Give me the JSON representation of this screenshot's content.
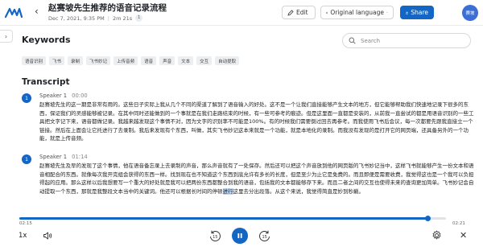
{
  "header": {
    "back_glyph": "‹",
    "title": "赵赛坡先生推荐的语音记录流程",
    "date": "Dec 7, 2021, 9:35 PM",
    "duration": "2m 21s",
    "badge_count": "1",
    "edit_label": "Edit",
    "language_label": "Original language",
    "share_label": "Share",
    "avatar_text": "赛坡"
  },
  "keywords": {
    "title": "Keywords",
    "search_placeholder": "Search",
    "tags": [
      "语音识别",
      "飞书",
      "录制",
      "飞书妙记",
      "上传音频",
      "语音",
      "声音",
      "文本",
      "交互",
      "自动提取"
    ]
  },
  "transcript": {
    "title": "Transcript",
    "segments": [
      {
        "avatar": "1",
        "speaker": "Speaker 1",
        "time": "00:00",
        "text": "赵赛坡先生的这一期是非常有用的。这些日子实际上我从几个不同的渠道了解到了语音输入的好处。这不是一个让我们直接能够产生文本的地方，但它能够帮助我们快速地记录下很多的东西，保证我们的灵感能够被记录。在其中同时还能做到的一个事就是在我们走路结束的时候，有一些可参考的痕迹。但是这里面一直都是安装的，从前我一直尝试的都是用语音识别的一些工具把文字记下来，语音都做记录。我越来越发现这个事情不对，因为文字的识别率不可能是100%。有的时候我们需要倒过回去再参考。而我使用飞书后会议，每一次都要先跟我直接立一个链接。然后在上面会让它托进行了去录制。我后来发现有个东西，叫做，其实飞书妙记这本来就是一个功能，就是本地化的录制。而我没有发现的是打开它的网页端，还具备另外的一个功能，就是上传音频。"
      },
      {
        "avatar": "1",
        "speaker": "Speaker 1",
        "time": "01:14",
        "text_before": "赵赛坡先生及早的发现了这个事情，他在语音备忘录上去录制的声音，那么声音就有了一处保存。然后还可以把这个声音放到他的网页版的飞书妙记当中，这样飞书就能够产生一份文本和语音相配合的东西。就像每次我开完组会获得的东西一样。找到现在也不知道这个东西到底允许有多长的长度，但是至少为止它是免费的。而且即便是需要收费，我觉得这也是一个我可以负担得起的应用。那么这样以后我想要写一个重大的好处就是我可以把两份东西都整合到我的语音，包括我的文本都能够存下来。而且二者之间的交互也使得未来的查询更加简单。飞书妙记会自动提取一个东西，那就是我整段文本当中的关键词。他还可以根据长时间的停顿",
        "highlight": "进行",
        "text_after": "这里去分出段落。从这个来说，我觉得简直是妙到秒巅。"
      }
    ]
  },
  "player": {
    "current_time": "02:15",
    "total_time": "02:21",
    "progress": 0.957,
    "speed": "1x",
    "skip_back_label": "15",
    "skip_fwd_label": "15"
  },
  "colors": {
    "accent": "#1466c4",
    "highlight": "#bcd6f6"
  },
  "icons": [
    "app-logo-icon",
    "back-arrow-icon",
    "edit-icon",
    "globe-icon",
    "chevron-down-icon",
    "share-icon",
    "search-icon",
    "volume-icon",
    "rewind-15-icon",
    "pause-icon",
    "forward-15-icon",
    "gear-icon",
    "close-icon",
    "expand-sidebar-icon"
  ]
}
